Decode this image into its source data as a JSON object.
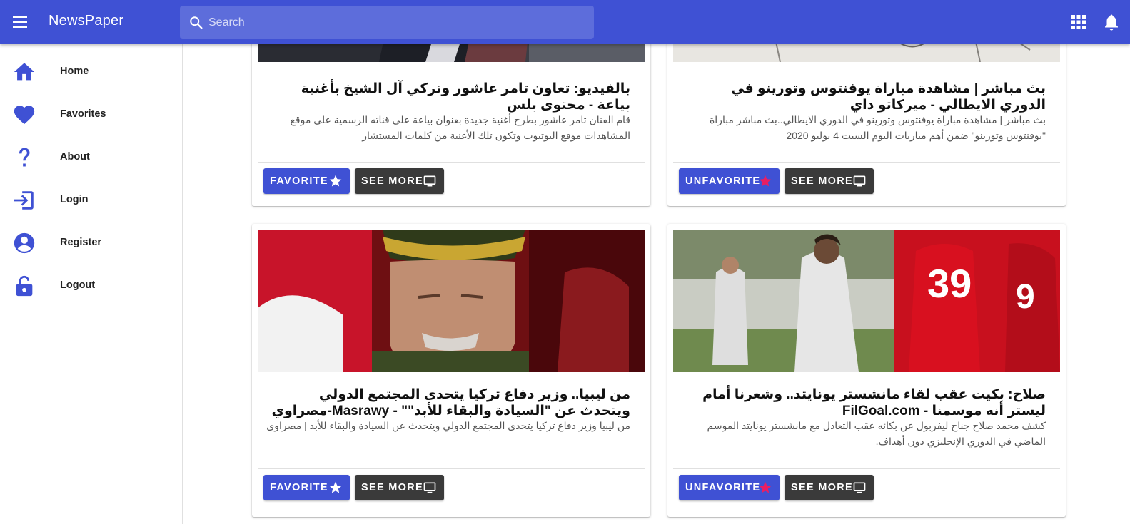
{
  "app": {
    "title": "NewsPaper"
  },
  "search": {
    "placeholder": "Search"
  },
  "icons": {
    "menu": "menu-icon",
    "search": "search-icon",
    "apps": "apps-grid-icon",
    "notifications": "bell-icon",
    "home": "home-icon",
    "favorites": "heart-icon",
    "about": "question-mark-icon",
    "login": "login-icon",
    "register": "account-circle-icon",
    "logout": "lock-open-icon",
    "favorite": "star-icon",
    "see_more": "monitor-icon"
  },
  "colors": {
    "primary": "#3f51d4",
    "dark_button": "#3a3a3a",
    "favorited_star": "#e91e63",
    "sidebar_icon": "#3f51d4"
  },
  "sidebar": {
    "items": [
      {
        "label": "Home"
      },
      {
        "label": "Favorites"
      },
      {
        "label": "About"
      },
      {
        "label": "Login"
      },
      {
        "label": "Register"
      },
      {
        "label": "Logout"
      }
    ]
  },
  "articles": [
    {
      "title": "بالفيديو: تعاون تامر عاشور وتركي آل الشيخ بأغنية بياعة - محتوى بلس",
      "description": "قام الفنان تامر عاشور بطرح أغنية جديدة بعنوان بياعة على قناته الرسمية على موقع المشاهدات موقع اليوتيوب وتكون تلك الأغنية من كلمات المستشار",
      "favorite_label": "FAVORITE",
      "favorited": false,
      "see_more_label": "SEE MORE"
    },
    {
      "title": "بث مباشر | مشاهدة مباراة يوفنتوس وتورينو في الدوري الايطالي - ميركاتو داي",
      "description": "بث مباشر | مشاهدة مباراة يوفنتوس وتورينو في الدوري الايطالي..بث مباشر مباراة \"يوفنتوس وتورينو\" ضمن أهم مباريات اليوم السبت 4 يوليو 2020",
      "favorite_label": "UNFAVORITE",
      "favorited": true,
      "see_more_label": "SEE MORE"
    },
    {
      "title": "من ليبيا.. وزير دفاع تركيا يتحدى المجتمع الدولي ويتحدث عن \"السيادة والبقاء للأبد\"\" - Masrawy-مصراوي",
      "description": "من ليبيا وزير دفاع تركيا يتحدى المجتمع الدولي ويتحدث عن السيادة والبقاء للأبد | مصراوى",
      "favorite_label": "FAVORITE",
      "favorited": false,
      "see_more_label": "SEE MORE"
    },
    {
      "title": "صلاح: بكيت عقب لقاء مانشستر يونايتد.. وشعرنا أمام ليستر أنه موسمنا - FilGoal.com",
      "description": "كشف محمد صلاح جناح ليفربول عن بكائه عقب التعادل مع مانشستر يونايتد الموسم الماضي في الدوري الإنجليزي دون أهداف.",
      "favorite_label": "UNFAVORITE",
      "favorited": true,
      "see_more_label": "SEE MORE"
    }
  ]
}
